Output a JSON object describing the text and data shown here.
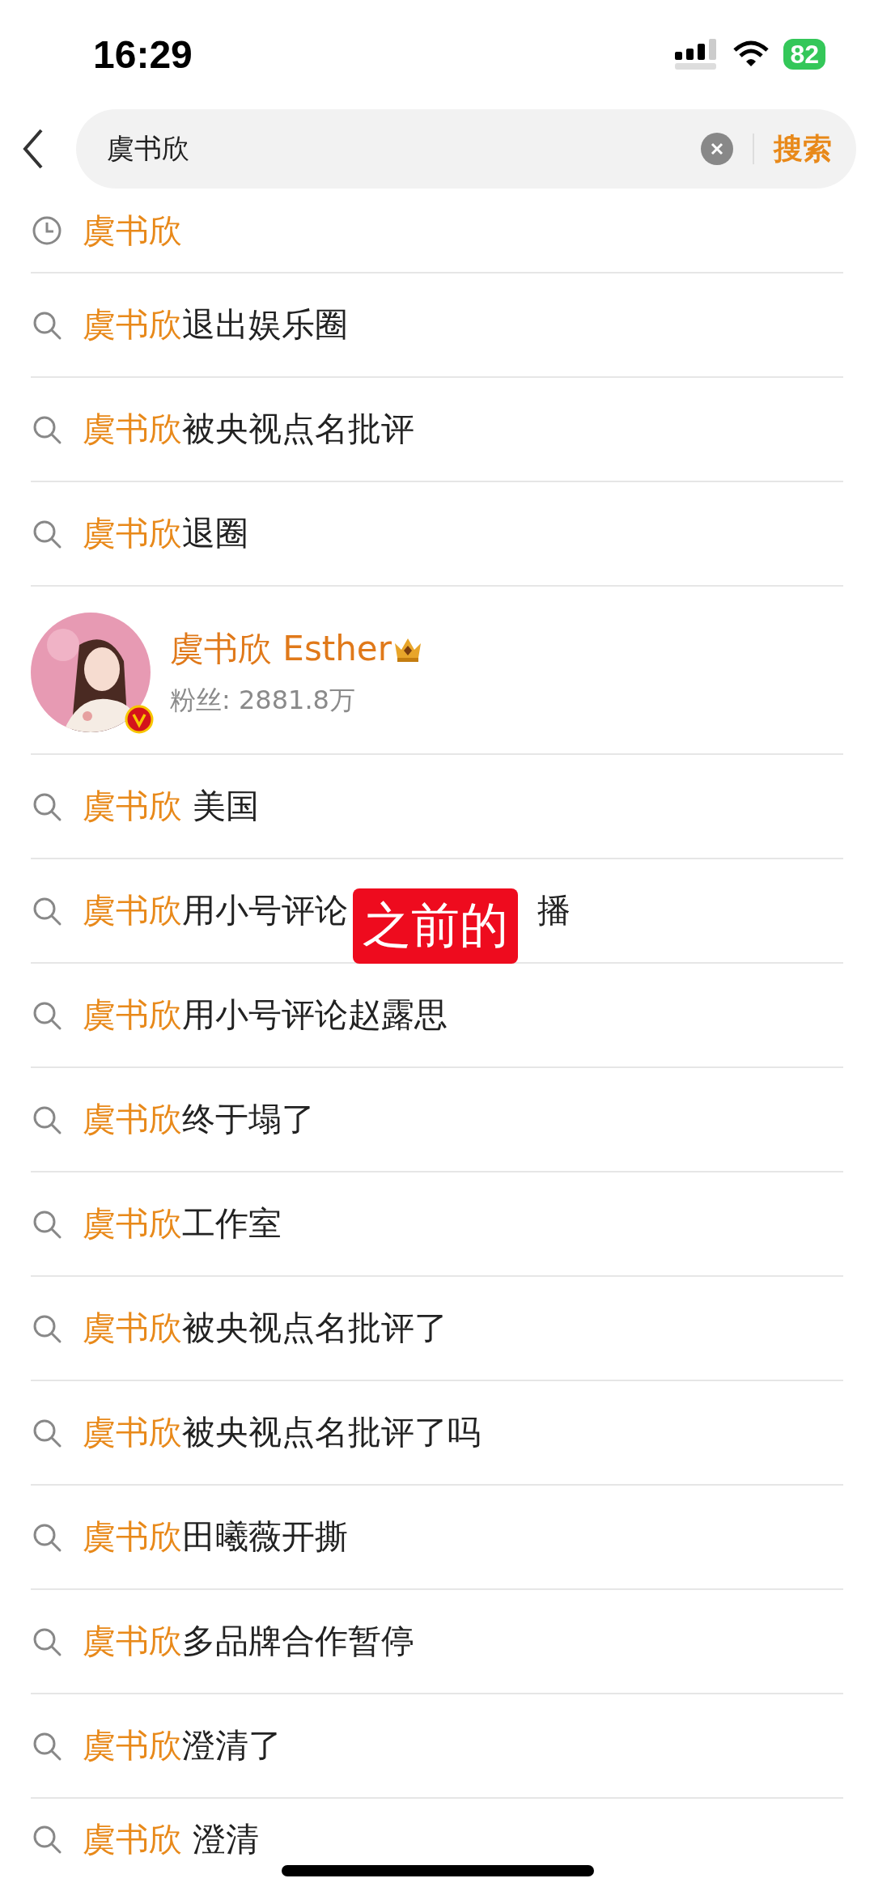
{
  "status_bar": {
    "time": "16:29",
    "battery": "82"
  },
  "search": {
    "value": "虞书欣",
    "action": "搜索"
  },
  "suggestions": [
    {
      "kind": "history",
      "match": "虞书欣"
    },
    {
      "kind": "query",
      "match": "虞书欣",
      "rest": "退出娱乐圈"
    },
    {
      "kind": "query",
      "match": "虞书欣",
      "rest": "被央视点名批评"
    },
    {
      "kind": "query",
      "match": "虞书欣",
      "rest": "退圈"
    },
    {
      "kind": "user",
      "name": "虞书欣 Esther",
      "fans": "粉丝: 2881.8万"
    },
    {
      "kind": "query",
      "match": "虞书欣",
      "rest": " 美国"
    },
    {
      "kind": "query",
      "match": "虞书欣",
      "rest": "用小号评论",
      "tail": "播",
      "overlay": "之前的"
    },
    {
      "kind": "query",
      "match": "虞书欣",
      "rest": "用小号评论赵露思"
    },
    {
      "kind": "query",
      "match": "虞书欣",
      "rest": "终于塌了"
    },
    {
      "kind": "query",
      "match": "虞书欣",
      "rest": "工作室"
    },
    {
      "kind": "query",
      "match": "虞书欣",
      "rest": "被央视点名批评了"
    },
    {
      "kind": "query",
      "match": "虞书欣",
      "rest": "被央视点名批评了吗"
    },
    {
      "kind": "query",
      "match": "虞书欣",
      "rest": "田曦薇开撕"
    },
    {
      "kind": "query",
      "match": "虞书欣",
      "rest": "多品牌合作暂停"
    },
    {
      "kind": "query",
      "match": "虞书欣",
      "rest": "澄清了"
    },
    {
      "kind": "query",
      "match": "虞书欣",
      "rest": " 澄清"
    }
  ]
}
